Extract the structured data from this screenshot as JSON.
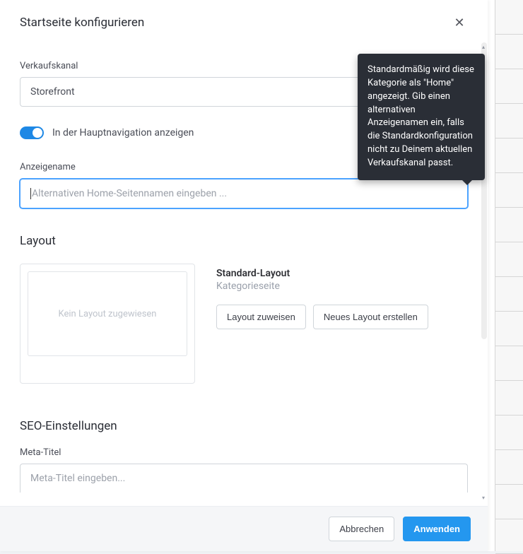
{
  "modal": {
    "title": "Startseite konfigurieren"
  },
  "sales_channel": {
    "label": "Verkaufskanal",
    "value": "Storefront"
  },
  "toggle_nav": {
    "label": "In der Hauptnavigation anzeigen"
  },
  "display_name": {
    "label": "Anzeigename",
    "placeholder": "Alternativen Home-Seitennamen eingeben ...",
    "help_tooltip": "Standardmäßig wird diese Kategorie als \"Home\" angezeigt. Gib einen alternativen Anzeigenamen ein, falls die Standardkonfiguration nicht zu Deinem aktuellen Verkaufskanal passt."
  },
  "layout": {
    "section_title": "Layout",
    "preview_placeholder": "Kein Layout zugewiesen",
    "meta_title": "Standard-Layout",
    "meta_subtitle": "Kategorieseite",
    "assign_label": "Layout zuweisen",
    "create_label": "Neues Layout erstellen"
  },
  "seo": {
    "section_title": "SEO-Einstellungen",
    "meta_title_label": "Meta-Titel",
    "meta_title_placeholder": "Meta-Titel eingeben..."
  },
  "footer": {
    "cancel_label": "Abbrechen",
    "apply_label": "Anwenden"
  }
}
